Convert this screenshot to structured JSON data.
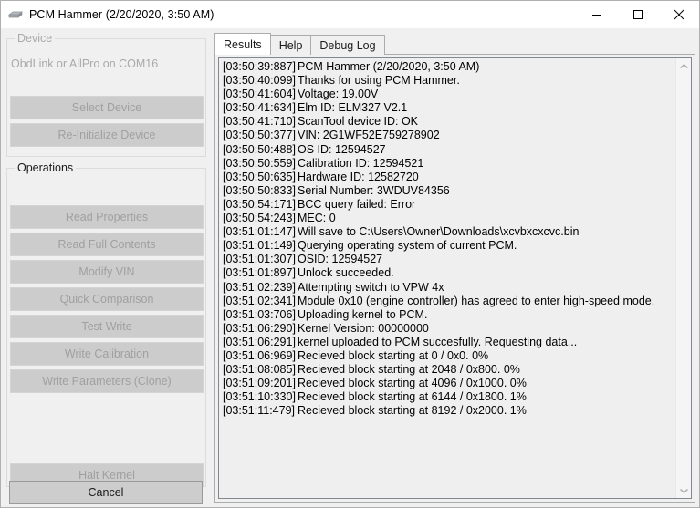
{
  "window": {
    "title": "PCM Hammer (2/20/2020, 3:50 AM)",
    "icon": "app-chip-icon",
    "minimize_label": "—",
    "maximize_label": "□",
    "close_label": "✕"
  },
  "device_group": {
    "label": "Device",
    "status": "ObdLink or AllPro on COM16",
    "buttons": [
      {
        "name": "select-device",
        "label": "Select Device",
        "enabled": false
      },
      {
        "name": "re-initialize-device",
        "label": "Re-Initialize Device",
        "enabled": false
      }
    ]
  },
  "operations_group": {
    "label": "Operations",
    "buttons": [
      {
        "name": "read-properties",
        "label": "Read Properties",
        "enabled": false
      },
      {
        "name": "read-full-contents",
        "label": "Read Full Contents",
        "enabled": false
      },
      {
        "name": "modify-vin",
        "label": "Modify VIN",
        "enabled": false
      },
      {
        "name": "quick-comparison",
        "label": "Quick Comparison",
        "enabled": false
      },
      {
        "name": "test-write",
        "label": "Test Write",
        "enabled": false
      },
      {
        "name": "write-calibration",
        "label": "Write Calibration",
        "enabled": false
      },
      {
        "name": "write-parameters-clone",
        "label": "Write Parameters (Clone)",
        "enabled": false
      },
      {
        "name": "halt-kernel",
        "label": "Halt Kernel",
        "enabled": false
      }
    ]
  },
  "cancel_button": {
    "label": "Cancel",
    "enabled": true
  },
  "tabs": [
    {
      "label": "Results",
      "active": true
    },
    {
      "label": "Help",
      "active": false
    },
    {
      "label": "Debug Log",
      "active": false
    }
  ],
  "scrollbar": {
    "up_arrow": "chevron-up-icon",
    "down_arrow": "chevron-down-icon"
  },
  "log": {
    "lines": [
      {
        "ts": "[03:50:39:887]",
        "msg": "PCM Hammer (2/20/2020, 3:50 AM)"
      },
      {
        "ts": "[03:50:40:099]",
        "msg": "Thanks for using PCM Hammer."
      },
      {
        "ts": "[03:50:41:604]",
        "msg": "Voltage: 19.00V"
      },
      {
        "ts": "[03:50:41:634]",
        "msg": "Elm ID: ELM327 V2.1"
      },
      {
        "ts": "[03:50:41:710]",
        "msg": "ScanTool device ID: OK"
      },
      {
        "ts": "[03:50:50:377]",
        "msg": "VIN: 2G1WF52E759278902"
      },
      {
        "ts": "[03:50:50:488]",
        "msg": "OS ID: 12594527"
      },
      {
        "ts": "[03:50:50:559]",
        "msg": "Calibration ID: 12594521"
      },
      {
        "ts": "[03:50:50:635]",
        "msg": "Hardware ID: 12582720"
      },
      {
        "ts": "[03:50:50:833]",
        "msg": "Serial Number: 3WDUV84356"
      },
      {
        "ts": "[03:50:54:171]",
        "msg": "BCC query failed: Error"
      },
      {
        "ts": "[03:50:54:243]",
        "msg": "MEC: 0"
      },
      {
        "ts": "[03:51:01:147]",
        "msg": "Will save to C:\\Users\\Owner\\Downloads\\xcvbxcxcvc.bin"
      },
      {
        "ts": "[03:51:01:149]",
        "msg": "Querying operating system of current PCM."
      },
      {
        "ts": "[03:51:01:307]",
        "msg": "OSID: 12594527"
      },
      {
        "ts": "[03:51:01:897]",
        "msg": "Unlock succeeded."
      },
      {
        "ts": "[03:51:02:239]",
        "msg": "Attempting switch to VPW 4x"
      },
      {
        "ts": "[03:51:02:341]",
        "msg": "Module 0x10 (engine controller) has agreed to enter high-speed mode."
      },
      {
        "ts": "[03:51:03:706]",
        "msg": "Uploading kernel to PCM."
      },
      {
        "ts": "[03:51:06:290]",
        "msg": "Kernel Version: 00000000"
      },
      {
        "ts": "[03:51:06:291]",
        "msg": "kernel uploaded to PCM succesfully. Requesting data..."
      },
      {
        "ts": "[03:51:06:969]",
        "msg": "Recieved block starting at 0 / 0x0. 0%"
      },
      {
        "ts": "[03:51:08:085]",
        "msg": "Recieved block starting at 2048 / 0x800. 0%"
      },
      {
        "ts": "[03:51:09:201]",
        "msg": "Recieved block starting at 4096 / 0x1000. 0%"
      },
      {
        "ts": "[03:51:10:330]",
        "msg": "Recieved block starting at 6144 / 0x1800. 1%"
      },
      {
        "ts": "[03:51:11:479]",
        "msg": "Recieved block starting at 8192 / 0x2000. 1%"
      }
    ]
  }
}
